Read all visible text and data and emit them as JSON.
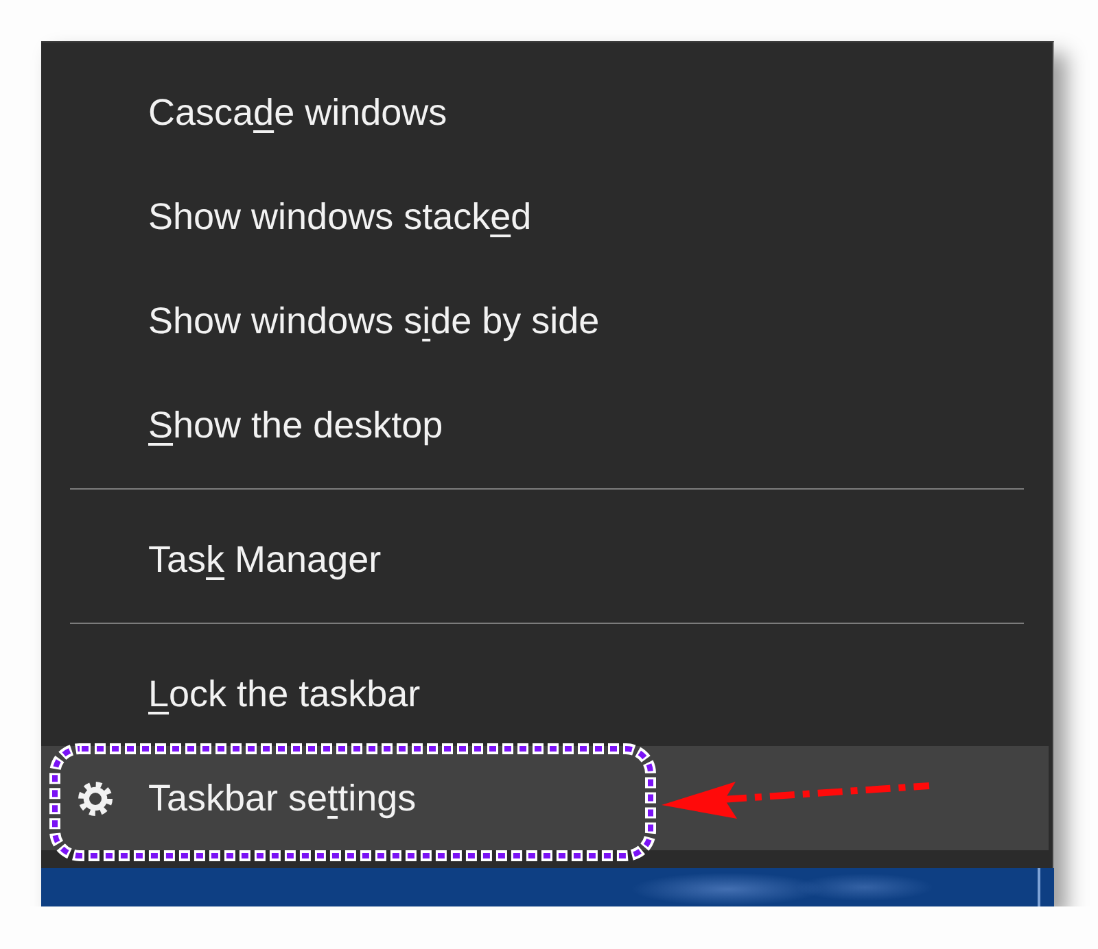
{
  "menu": {
    "items": [
      {
        "kind": "command",
        "label_start": "Casca",
        "access_key": "d",
        "label_end": "e windows",
        "selected": false
      },
      {
        "kind": "command",
        "label_start": "Show windows stack",
        "access_key": "e",
        "label_end": "d",
        "selected": false
      },
      {
        "kind": "command",
        "label_start": "Show windows s",
        "access_key": "i",
        "label_end": "de by side",
        "selected": false
      },
      {
        "kind": "command",
        "access_key": "S",
        "label_end": "how the desktop",
        "selected": false
      },
      {
        "kind": "separator"
      },
      {
        "kind": "command",
        "label_start": "Tas",
        "access_key": "k",
        "label_end": " Manager",
        "selected": false
      },
      {
        "kind": "separator"
      },
      {
        "kind": "command",
        "access_key": "L",
        "label_end": "ock the taskbar",
        "selected": false
      },
      {
        "kind": "settings",
        "label_start": "Taskbar se",
        "access_key": "t",
        "label_end": "tings",
        "selected": true
      }
    ]
  }
}
